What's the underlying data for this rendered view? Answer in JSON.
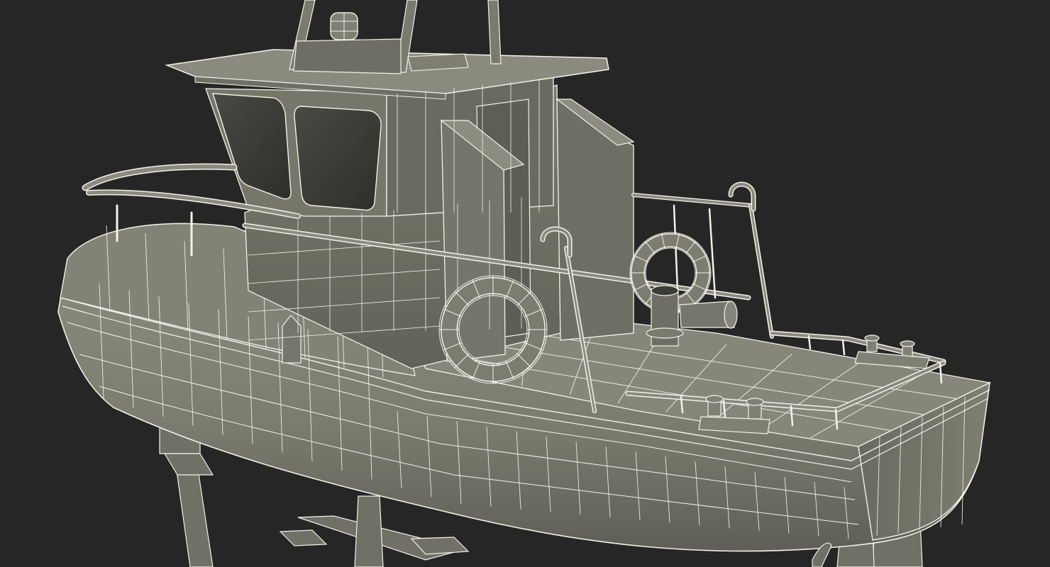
{
  "scene": {
    "subject": "tugboat-wireframe-render",
    "colors": {
      "background": "#262626",
      "hull_fill": "#7c7c70",
      "hull_light": "#8e8e82",
      "hull_dark": "#55554d",
      "deck_fill": "#86867a",
      "cabin_fill": "#6e6e64",
      "window_fill": "#3a3a36",
      "wire": "#f2f2ea",
      "shadow": "#3e3e38"
    }
  }
}
